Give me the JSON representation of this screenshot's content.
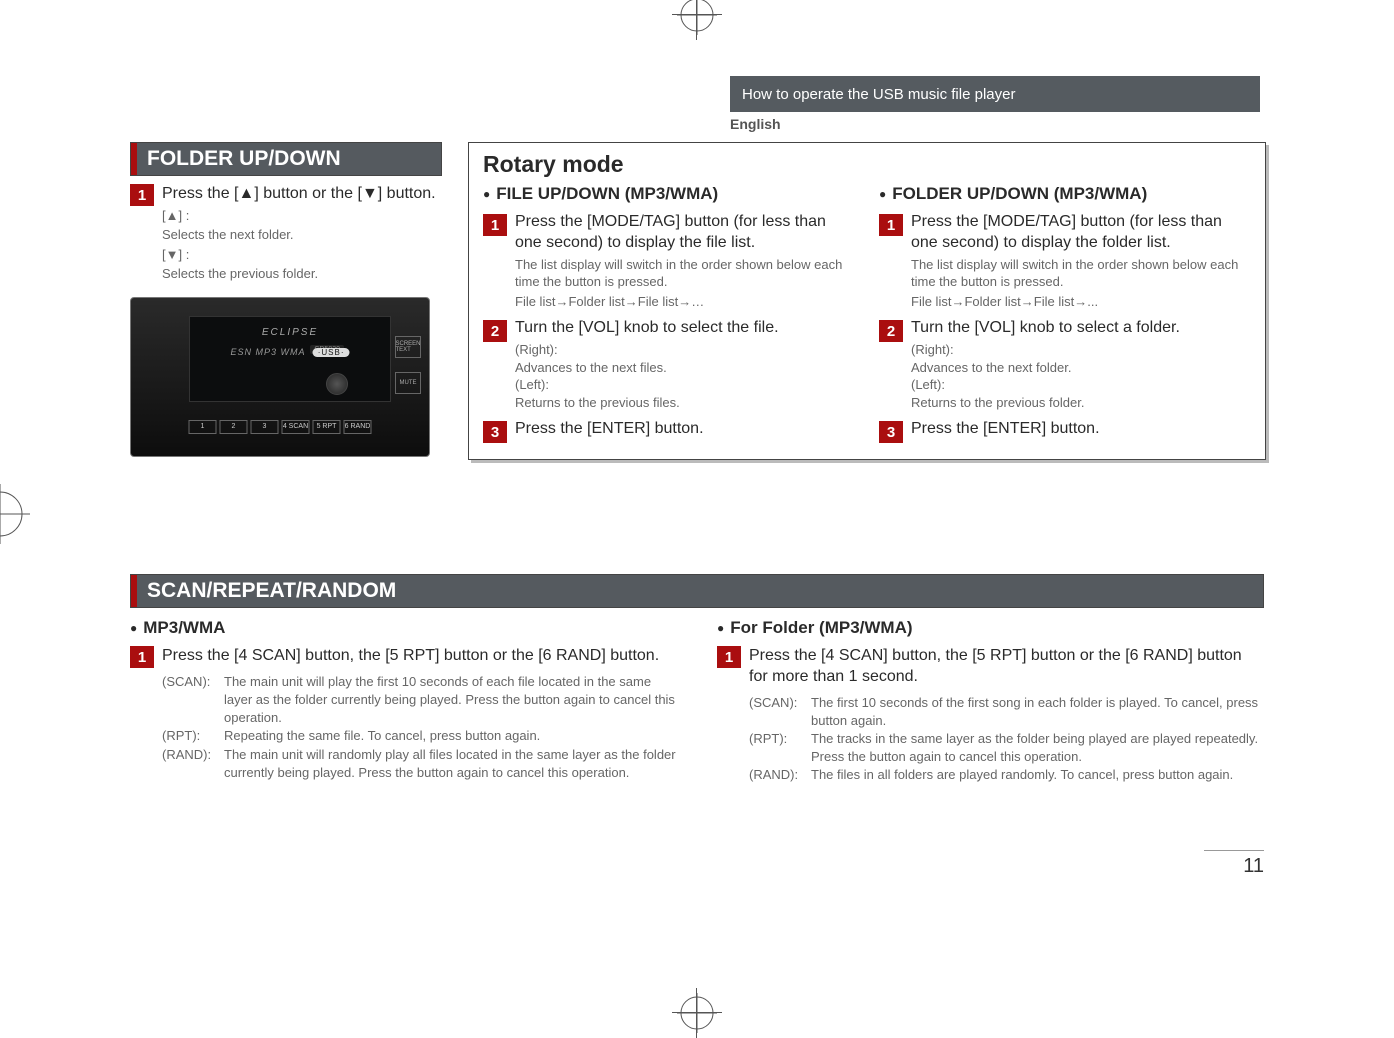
{
  "header": {
    "section": "How to operate the USB music file player",
    "language": "English"
  },
  "folder_updown": {
    "title": "FOLDER UP/DOWN",
    "step1": {
      "text": "Press the [▲] button or the [▼] button.",
      "s1": "[▲] :",
      "s2": "Selects the next folder.",
      "s3": "[▼] :",
      "s4": "Selects the previous folder."
    }
  },
  "device": {
    "logo": "ECLIPSE",
    "model": "CD5030",
    "tags": "ESN   MP3   WMA",
    "usb": "·USB·",
    "buttons": [
      "1",
      "2",
      "3",
      "4 SCAN",
      "5 RPT",
      "6 RAND"
    ],
    "side1": "SCREEN TEXT",
    "side2": "MUTE"
  },
  "rotary": {
    "title": "Rotary mode",
    "file": {
      "head": "FILE UP/DOWN (MP3/WMA)",
      "s1": {
        "main": "Press the [MODE/TAG] button (for less than one second) to display the file list.",
        "sub1": "The list display will switch in the order shown below each time the button is pressed.",
        "sub2": "File list→Folder list→File list→…"
      },
      "s2": {
        "main": "Turn the [VOL] knob to select the file.",
        "sub": "(Right):\nAdvances to the next files.\n(Left):\nReturns to the previous files."
      },
      "s3": {
        "main": "Press the [ENTER] button."
      }
    },
    "folder": {
      "head": "FOLDER UP/DOWN (MP3/WMA)",
      "s1": {
        "main": "Press the [MODE/TAG] button (for less than one second) to display the folder list.",
        "sub1": "The list display will switch in the order shown below each time the button is pressed.",
        "sub2": "File list→Folder list→File list→..."
      },
      "s2": {
        "main": "Turn the [VOL] knob to select a folder.",
        "sub": "(Right):\nAdvances to the next folder.\n(Left):\nReturns to the previous folder."
      },
      "s3": {
        "main": "Press the [ENTER] button."
      }
    }
  },
  "scan": {
    "title": "SCAN/REPEAT/RANDOM",
    "mp3": {
      "head": "MP3/WMA",
      "s1": "Press the [4 SCAN] button, the [5 RPT] button or the [6 RAND] button.",
      "fn_scan_k": "(SCAN):",
      "fn_scan_v": "The main unit will play the first 10 seconds of each file located in the same layer as the folder currently being played. Press the button again to cancel this operation.",
      "fn_rpt_k": "(RPT):",
      "fn_rpt_v": "Repeating the same file. To cancel, press button again.",
      "fn_rand_k": "(RAND):",
      "fn_rand_v": "The main unit will randomly play all files located in the same layer as the folder currently being played. Press the button again to cancel this operation."
    },
    "folder": {
      "head": "For Folder (MP3/WMA)",
      "s1": "Press the [4 SCAN] button, the [5 RPT] button or the [6 RAND] button for more than 1 second.",
      "fn_scan_k": "(SCAN):",
      "fn_scan_v": "The first 10 seconds of the first song in each folder is played. To cancel, press button again.",
      "fn_rpt_k": "(RPT):",
      "fn_rpt_v": "The tracks in the same layer as the folder being played are played repeatedly. Press the button again to cancel this operation.",
      "fn_rand_k": "(RAND):",
      "fn_rand_v": "The files in all folders are played randomly. To cancel, press button again."
    }
  },
  "page": "11"
}
